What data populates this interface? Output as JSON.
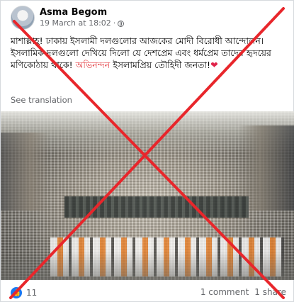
{
  "author": {
    "name": "Asma Begom",
    "timestamp": "19 March at 18:02",
    "separator": "·"
  },
  "post": {
    "text_part1": "মাশাল্লাহ! ঢাকায় ইসলামী দলগুলোর আজকের মোদী বিরোধী আন্দোলন। ইসলামিক দলগুলো দেখিয়ে দিলো যে দেশপ্রেম এবং ধর্মপ্রেম তাদের হৃদয়ের মণিকোঠায় থাকে! ",
    "text_highlight": "অভিনন্দন",
    "text_part2": " ইসলামপ্রিয় তৌহিদী জনতা!",
    "text_emoji": "❤",
    "see_translation": "See translation"
  },
  "footer": {
    "like_count": "11",
    "comments": "1 comment",
    "shares": "1 share"
  },
  "icons": {
    "like": "like-icon",
    "globe": "globe-icon"
  },
  "colors": {
    "like_blue": "#1877f2",
    "highlight_red": "#e5484d",
    "cross_red": "#e8262b"
  }
}
